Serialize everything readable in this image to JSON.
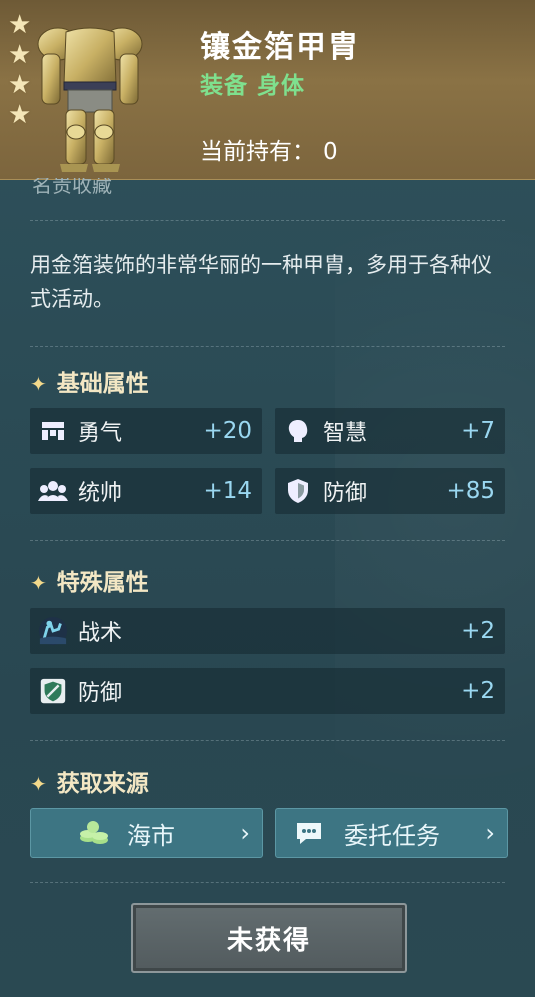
{
  "item": {
    "name": "镶金箔甲胄",
    "type": "装备 身体",
    "owned_label": "当前持有：",
    "owned_value": "0",
    "stars": 4,
    "cut_text": "名贵收藏",
    "description": "用金箔装饰的非常华丽的一种甲胄，多用于各种仪式活动。"
  },
  "basic": {
    "title": "基础属性",
    "stats": [
      {
        "label": "勇气",
        "value": "+20",
        "icon": "courage-icon"
      },
      {
        "label": "智慧",
        "value": "+7",
        "icon": "wisdom-icon"
      },
      {
        "label": "统帅",
        "value": "+14",
        "icon": "command-icon"
      },
      {
        "label": "防御",
        "value": "+85",
        "icon": "shield-icon"
      }
    ]
  },
  "special": {
    "title": "特殊属性",
    "stats": [
      {
        "label": "战术",
        "value": "+2",
        "icon": "tactics-icon"
      },
      {
        "label": "防御",
        "value": "+2",
        "icon": "defense-skill-icon"
      }
    ]
  },
  "source": {
    "title": "获取来源",
    "buttons": [
      {
        "label": "海市",
        "icon": "coins-icon"
      },
      {
        "label": "委托任务",
        "icon": "chat-bubble-icon"
      }
    ]
  },
  "action": {
    "label": "未获得"
  },
  "colors": {
    "accent_green": "#7fe08e",
    "value_blue": "#9ad7f0",
    "header_gold": "#8a7245",
    "button_teal": "#3d7583"
  }
}
